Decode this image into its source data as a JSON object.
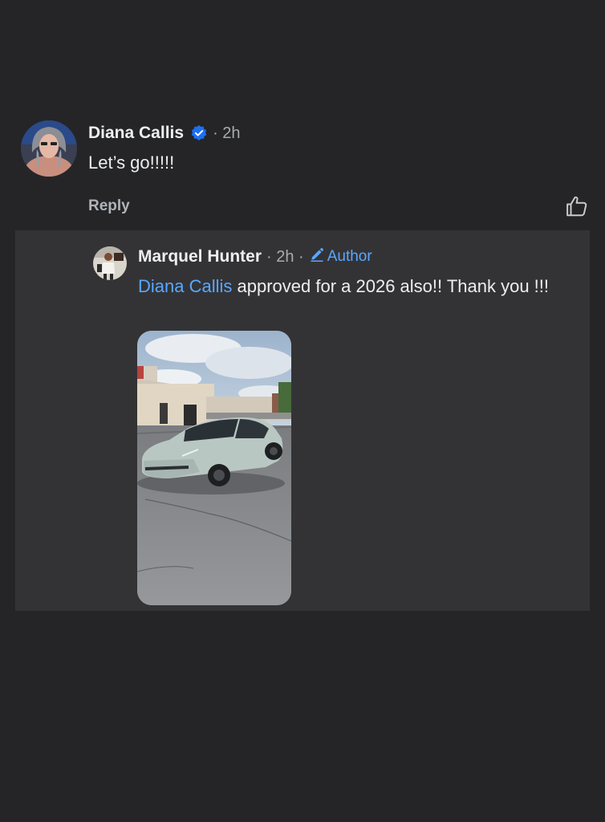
{
  "comment": {
    "author": "Diana Callis",
    "verified": true,
    "meta": "· 2h",
    "text": "Let’s go!!!!!",
    "reply_label": "Reply",
    "like_icon": "thumbs-up-icon"
  },
  "reply": {
    "author": "Marquel Hunter",
    "meta": "· 2h ·",
    "badge_label": "Author",
    "badge_icon": "pencil-icon",
    "mention": "Diana Callis",
    "text": " approved for a 2026 also!! Thank you !!!",
    "attachment": "car-photo"
  },
  "colors": {
    "background": "#252527",
    "panel": "#333336",
    "link": "#5aa7ff",
    "verified": "#1d6ff2"
  }
}
